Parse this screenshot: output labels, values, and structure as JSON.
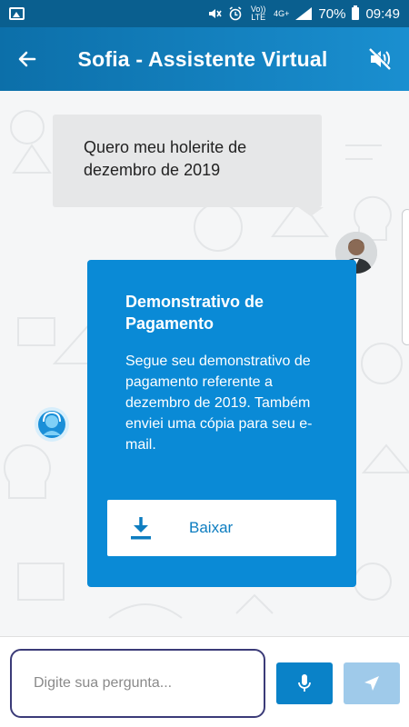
{
  "status_bar": {
    "network_volte": "Vo)) LTE",
    "network_4g": "4G+",
    "battery_percent": "70%",
    "time": "09:49",
    "icons": [
      "image-icon",
      "mute-icon",
      "alarm-icon",
      "volte-icon",
      "4g-icon",
      "signal-icon",
      "battery-icon"
    ]
  },
  "header": {
    "title": "Sofia - Assistente Virtual",
    "back_icon": "arrow-left-icon",
    "mute_icon": "volume-off-icon"
  },
  "chat": {
    "user_message": {
      "line1": "Quero meu holerite de",
      "line2": "dezembro de 2019"
    },
    "bot_card": {
      "title": "Demonstrativo de Pagamento",
      "text": "Segue seu demonstrativo de pagamento referente a dezembro de 2019. Também enviei uma cópia para seu e-mail.",
      "button_label": "Baixar",
      "button_icon": "download-icon"
    }
  },
  "input_bar": {
    "placeholder": "Digite sua pergunta...",
    "mic_icon": "microphone-icon",
    "send_icon": "send-icon"
  },
  "colors": {
    "header_start": "#0c6fa9",
    "header_end": "#1a8fd0",
    "card": "#0a8ad6",
    "user_bubble": "#e6e7e8",
    "input_border": "#3b3b78",
    "mic_button": "#0a82c8",
    "send_button_disabled": "#9fcaea"
  }
}
